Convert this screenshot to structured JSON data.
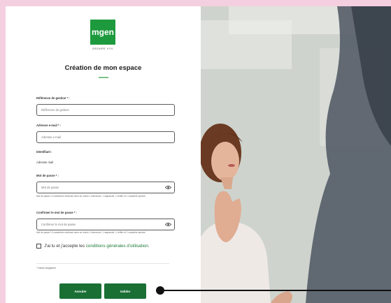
{
  "brand": {
    "logo_text": "mgen",
    "logo_subtext": "GROUPE VYV"
  },
  "form": {
    "title": "Création de mon espace",
    "reference": {
      "label": "Référence de gestion * :",
      "placeholder": "Référence de gestion"
    },
    "email": {
      "label": "Adresse e-mail * :",
      "placeholder": "Adresse e-mail"
    },
    "identifiant": {
      "label": "Identifiant :",
      "value": "Adresse mail"
    },
    "password": {
      "label": "Mot de passe * :",
      "placeholder": "Mot de passe",
      "helper": "Mot de passe 12 caractères minimum avec au moins 1 minuscule, 1 majuscule, 1 chiffre et 1 caractère spécial",
      "eye_icon": "eye-icon"
    },
    "confirm_password": {
      "label": "Confirmer le mot de passe * :",
      "placeholder": "Confirmer le mot de passe",
      "helper": "Mot de passe 12 caractères minimum avec au moins 1 minuscule, 1 majuscule, 1 chiffre et 1 caractère spécial",
      "eye_icon": "eye-icon"
    },
    "terms": {
      "prefix": "J'ai lu et j'accepte les",
      "link": "conditions générales d'utilisation",
      "suffix": "."
    },
    "required_note": "* Saisie obligatoire",
    "buttons": {
      "cancel": "Annuler",
      "submit": "Valider"
    }
  },
  "colors": {
    "brand_green": "#1e9a3e",
    "button_green": "#1a6f34",
    "background_pink": "#f4cfe0"
  }
}
